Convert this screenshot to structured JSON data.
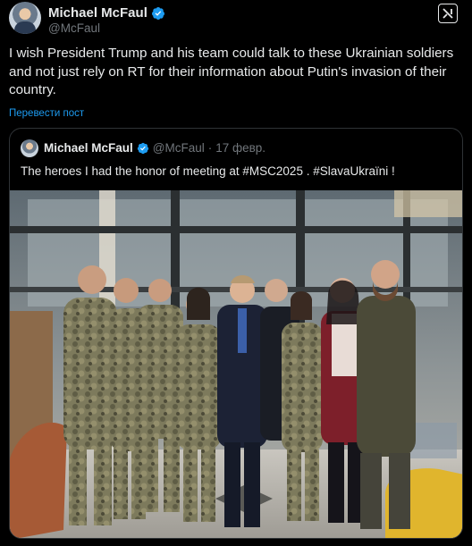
{
  "author": {
    "name": "Michael McFaul",
    "handle": "@McFaul"
  },
  "tweet": {
    "text": "I wish President Trump and his team could talk to these Ukrainian soldiers and not just rely on RT for their information about Putin's invasion of their country.",
    "translate_label": "Перевести пост"
  },
  "quoted": {
    "name": "Michael McFaul",
    "handle": "@McFaul",
    "separator": "·",
    "date": "17 февр.",
    "text": "The heroes I had the honor of meeting at #MSC2025 . #SlavaUkraïni !"
  },
  "colors": {
    "background": "#000000",
    "text": "#e7e9ea",
    "secondary": "#71767b",
    "accent": "#1d9bf0",
    "border": "#2f3336"
  },
  "icons": [
    "verified-badge-icon",
    "grok-icon"
  ]
}
